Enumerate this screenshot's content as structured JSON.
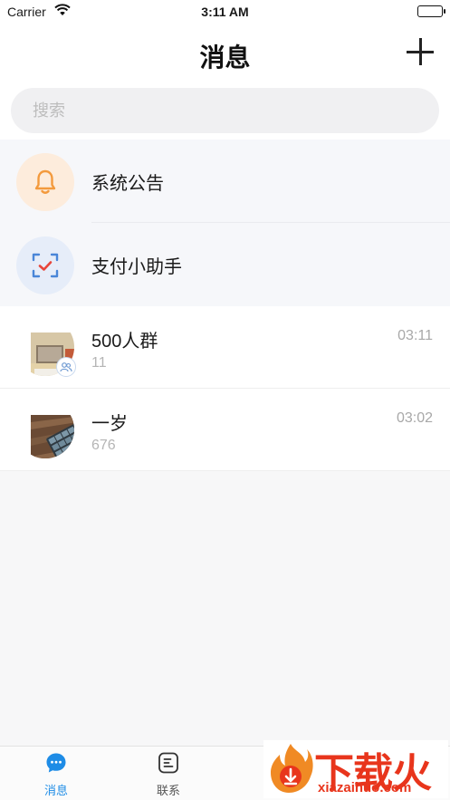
{
  "status_bar": {
    "carrier": "Carrier",
    "time": "3:11 AM"
  },
  "nav": {
    "title": "消息"
  },
  "search": {
    "placeholder": "搜索"
  },
  "system_items": [
    {
      "label": "系统公告",
      "icon": "bell-icon"
    },
    {
      "label": "支付小助手",
      "icon": "scan-check-icon"
    }
  ],
  "chats": [
    {
      "name": "500人群",
      "preview": "11",
      "time": "03:11",
      "is_group": true
    },
    {
      "name": "一岁",
      "preview": "676",
      "time": "03:02",
      "is_group": false
    }
  ],
  "tabs": [
    {
      "label": "消息",
      "icon": "chat-bubble-icon",
      "active": true
    },
    {
      "label": "联系",
      "icon": "contacts-icon",
      "active": false
    }
  ],
  "watermark": {
    "brand_cn": "下载火",
    "brand_en": "xiazaihuo.com"
  },
  "colors": {
    "accent": "#1e8ce6",
    "bell": "#f39a3d",
    "pay": "#4a86d8",
    "watermark": "#e8351c"
  }
}
